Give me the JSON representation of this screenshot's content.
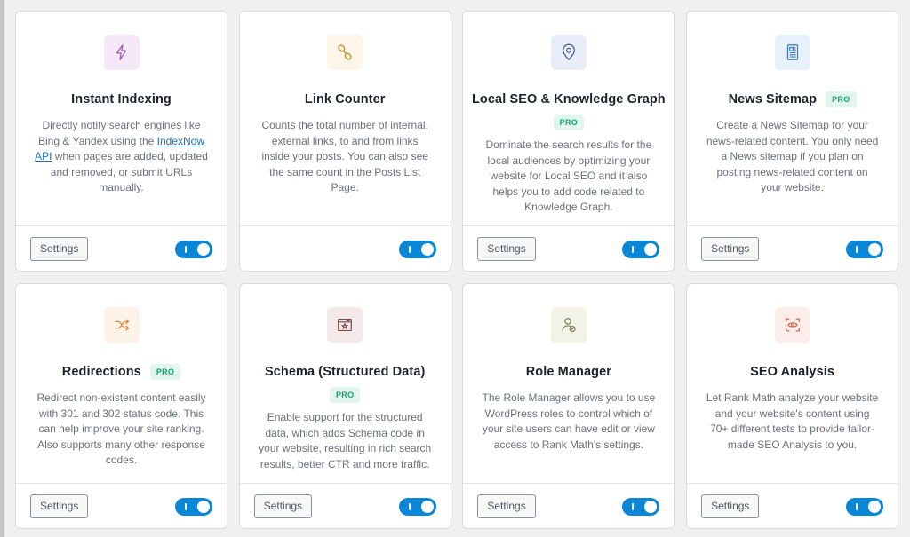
{
  "modules": [
    {
      "title": "Instant Indexing",
      "pro": false,
      "pro_label": "",
      "desc_before": "Directly notify search engines like Bing & Yandex using the ",
      "link": "IndexNow API",
      "desc_after": " when pages are added, updated and removed, or submit URLs manually.",
      "has_settings": true,
      "settings_label": "Settings",
      "enabled": true,
      "icon": "lightning-icon",
      "icon_bg": "#f5e9f8",
      "icon_color": "#9b59b6"
    },
    {
      "title": "Link Counter",
      "pro": false,
      "pro_label": "",
      "description": "Counts the total number of internal, external links, to and from links inside your posts. You can also see the same count in the Posts List Page.",
      "has_settings": false,
      "settings_label": "",
      "enabled": true,
      "icon": "link-icon",
      "icon_bg": "#fdf5e7",
      "icon_color": "#c58a2c"
    },
    {
      "title": "Local SEO & Knowledge Graph",
      "pro": true,
      "pro_label": "PRO",
      "description": "Dominate the search results for the local audiences by optimizing your website for Local SEO and it also helps you to add code related to Knowledge Graph.",
      "has_settings": true,
      "settings_label": "Settings",
      "enabled": true,
      "icon": "map-pin-icon",
      "icon_bg": "#e9edf9",
      "icon_color": "#4a5a8c"
    },
    {
      "title": "News Sitemap",
      "pro": true,
      "pro_label": "PRO",
      "description": "Create a News Sitemap for your news-related content. You only need a News sitemap if you plan on posting news-related content on your website.",
      "has_settings": true,
      "settings_label": "Settings",
      "enabled": true,
      "icon": "newspaper-icon",
      "icon_bg": "#e7f1fb",
      "icon_color": "#3f7cbf"
    },
    {
      "title": "Redirections",
      "pro": true,
      "pro_label": "PRO",
      "description": "Redirect non-existent content easily with 301 and 302 status code. This can help improve your site ranking. Also supports many other response codes.",
      "has_settings": true,
      "settings_label": "Settings",
      "enabled": true,
      "icon": "shuffle-icon",
      "icon_bg": "#fdf2e7",
      "icon_color": "#e08a3c"
    },
    {
      "title": "Schema (Structured Data)",
      "pro": true,
      "pro_label": "PRO",
      "description": "Enable support for the structured data, which adds Schema code in your website, resulting in rich search results, better CTR and more traffic.",
      "has_settings": true,
      "settings_label": "Settings",
      "enabled": true,
      "icon": "schema-window-icon",
      "icon_bg": "#f3e9e9",
      "icon_color": "#7a4b4b"
    },
    {
      "title": "Role Manager",
      "pro": false,
      "pro_label": "",
      "description": "The Role Manager allows you to use WordPress roles to control which of your site users can have edit or view access to Rank Math's settings.",
      "has_settings": true,
      "settings_label": "Settings",
      "enabled": true,
      "icon": "user-role-icon",
      "icon_bg": "#f2f2e6",
      "icon_color": "#7a7a55"
    },
    {
      "title": "SEO Analysis",
      "pro": false,
      "pro_label": "",
      "description": "Let Rank Math analyze your website and your website's content using 70+ different tests to provide tailor-made SEO Analysis to you.",
      "has_settings": true,
      "settings_label": "Settings",
      "enabled": true,
      "icon": "eye-scan-icon",
      "icon_bg": "#fbede9",
      "icon_color": "#d06a4f"
    }
  ]
}
